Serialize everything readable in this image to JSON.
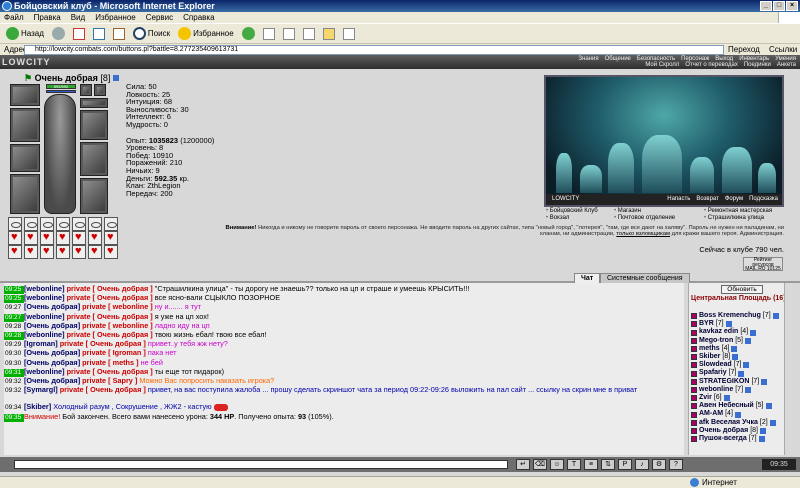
{
  "window": {
    "title": "Бойцовский клуб - Microsoft Internet Explorer"
  },
  "menu": [
    "Файл",
    "Правка",
    "Вид",
    "Избранное",
    "Сервис",
    "Справка"
  ],
  "toolbar": {
    "back": "Назад",
    "search": "Поиск",
    "favorites": "Избранное"
  },
  "address": {
    "label": "Адрес",
    "url": "http://lowcity.combats.com/buttons.pl?battle=8.277235409613731",
    "go": "Переход",
    "links": "Ссылки"
  },
  "header": {
    "logo": "LOWCITY",
    "nav": [
      "Знания",
      "Общение",
      "Безопасность",
      "Персонаж",
      "Выход",
      "Инвентарь",
      "Умения",
      "Мой Скролл",
      "Отчет о переводах",
      "Поединки",
      "Анкета"
    ]
  },
  "character": {
    "name": "Очень добрая",
    "level": "[8]",
    "hp": "592/592",
    "stats": [
      "Сила: 50",
      "Ловкость: 25",
      "Интуиция: 68",
      "Выносливость: 30",
      "Интеллект: 6",
      "Мудрость: 0"
    ],
    "exp_label": "Опыт:",
    "exp_value": "1035823",
    "exp_next": "(1200000)",
    "level_line": "Уровень: 8",
    "wins": "Побед: 10910",
    "losses": "Поражений: 210",
    "draws": "Ничьих: 9",
    "money_label": "Деньги:",
    "money_value": "592.35",
    "money_unit": "кр.",
    "clan": "Клан: ZthLegion",
    "transfers": "Передач: 200"
  },
  "location": {
    "name": "LOWCITY",
    "actions": [
      "Напасть",
      "Возврат",
      "Форум",
      "Подсказка"
    ],
    "links": [
      "Бойцовский Клуб",
      "Магазин",
      "Ремонтная мастерская",
      "Вокзал",
      "Почтовое отделение",
      "Страшилкина улица"
    ]
  },
  "warning": {
    "label": "Внимание!",
    "text": "Никогда и никому не говорите пароль от своего персонажа. Не вводите пароль на других сайтах, типа \"новый город\", \"лотерея\", \"там, где все дают на халяву\". Пароль не нужен ни паладинам, ни кланам, ни администрации,",
    "link": "только взломщикам",
    "tail": "для кражи вашего героя. Администрация."
  },
  "online": "Сейчас в клубе 790 чел.",
  "counter": "Рейтинг ресурсов MAIL.RU 10125",
  "chat_tabs": {
    "chat": "Чат",
    "system": "Системные сообщения"
  },
  "chat": [
    {
      "time": "09:25",
      "hl": true,
      "sender": "[webonline]",
      "private": "private",
      "target": "[ Очень добрая ]",
      "text": "\"Страшилкина улица\" - ты дорогу не знаешь?? только на цп и страше и умеешь КРЫСИТЬ!!!",
      "tc": ""
    },
    {
      "time": "09:25",
      "hl": true,
      "sender": "[webonline]",
      "private": "private",
      "target": "[ Очень добрая ]",
      "text": "все ясно-вали СЦЫКЛО ПОЗОРНОЕ",
      "tc": ""
    },
    {
      "time": "09:27",
      "hl": false,
      "sender": "[Очень добрая]",
      "private": "private",
      "target": "[ webonline ]",
      "text": "ну и....... я тут",
      "tc": "pink"
    },
    {
      "time": "09:27",
      "hl": true,
      "sender": "[webonline]",
      "private": "private",
      "target": "[ Очень добрая ]",
      "text": "я уже на цп хох!",
      "tc": ""
    },
    {
      "time": "09:28",
      "hl": false,
      "sender": "[Очень добрая]",
      "private": "private",
      "target": "[ webonline ]",
      "text": "ладно иду на цп",
      "tc": "pink"
    },
    {
      "time": "09:28",
      "hl": true,
      "sender": "[webonline]",
      "private": "private",
      "target": "[ Очень добрая ]",
      "text": "твою жизнь ебал! твою все ебал!",
      "tc": ""
    },
    {
      "time": "09:29",
      "hl": false,
      "sender": "[Igroman]",
      "private": "private",
      "target": "[ Очень добрая ]",
      "text": "привет..у тебя жж нету?",
      "tc": "pink"
    },
    {
      "time": "09:30",
      "hl": false,
      "sender": "[Очень добрая]",
      "private": "private",
      "target": "[ Igroman ]",
      "text": "пака нет",
      "tc": "pink"
    },
    {
      "time": "09:30",
      "hl": false,
      "sender": "[Очень добрая]",
      "private": "private",
      "target": "[ meths ]",
      "text": "не бей",
      "tc": "pink"
    },
    {
      "time": "09:31",
      "hl": true,
      "sender": "[webonline]",
      "private": "private",
      "target": "[ Очень добрая ]",
      "text": "ты еще тот пидарок)",
      "tc": ""
    },
    {
      "time": "09:32",
      "hl": false,
      "sender": "[Очень добрая]",
      "private": "private",
      "target": "[ Sapry ]",
      "text": "Можно Вас попросить наказать игрока?",
      "tc": "orange"
    },
    {
      "time": "09:32",
      "hl": false,
      "sender": "[Symargl]",
      "private": "private",
      "target": "[ Очень добрая ]",
      "text": "привет, на вас поступила жалоба ... прошу сделать скриншот чата за период 09:22-09:26 выложить на пал сайт ... ссылку на скрин мне в приват",
      "tc": "blue"
    }
  ],
  "chat_extra": [
    {
      "time": "09:34",
      "sender": "[Skiber]",
      "text": "Холодный разум , Сокрушение , ЖЖ2 - кастую"
    },
    {
      "time": "09:35",
      "warn": "Внимание!",
      "text": "Бой закончен. Всего вами нанесено урона:",
      "dmg": "344 HP",
      "text2": ". Получено опыта:",
      "exp": "93",
      "text3": "(105%)."
    }
  ],
  "sidebar": {
    "refresh": "Обновить",
    "room": "Центральная Площадь",
    "count": "(16)",
    "users": [
      {
        "name": "Boss Kremenchug",
        "lvl": "[7]"
      },
      {
        "name": "BYR",
        "lvl": "[7]"
      },
      {
        "name": "kavkaz edin",
        "lvl": "[4]"
      },
      {
        "name": "Mego-tron",
        "lvl": "[5]"
      },
      {
        "name": "meths",
        "lvl": "[4]"
      },
      {
        "name": "Skiber",
        "lvl": "[8]"
      },
      {
        "name": "Slowdead",
        "lvl": "[7]"
      },
      {
        "name": "Spafariy",
        "lvl": "[7]"
      },
      {
        "name": "STRATEGIKON",
        "lvl": "[7]"
      },
      {
        "name": "webonline",
        "lvl": "[7]"
      },
      {
        "name": "Zvir",
        "lvl": "[6]"
      },
      {
        "name": "Авен Небесный",
        "lvl": "[5]"
      },
      {
        "name": "AM-AM",
        "lvl": "[4]"
      },
      {
        "name": "afk Веселая Учка",
        "lvl": "[2]"
      },
      {
        "name": "Очень добрая",
        "lvl": "[8]"
      },
      {
        "name": "Пушок-всегда",
        "lvl": "[7]"
      }
    ]
  },
  "inputbar": {
    "clock": "09:35"
  },
  "statusbar": {
    "zone": "Интернет"
  }
}
